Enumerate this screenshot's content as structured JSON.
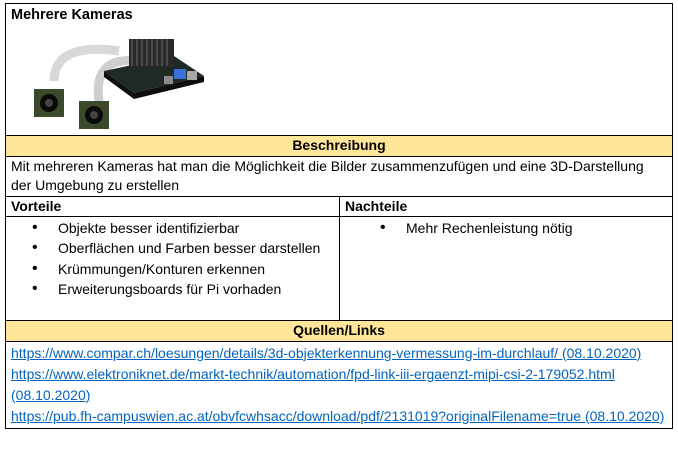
{
  "title": "Mehrere Kameras",
  "sections": {
    "beschreibung": "Beschreibung",
    "quellen": "Quellen/Links"
  },
  "description": "Mit mehreren Kameras hat man die Möglichkeit die Bilder zusammenzufügen und eine 3D-Darstellung der Umgebung zu erstellen",
  "vorteile": {
    "heading": "Vorteile",
    "items": [
      "Objekte besser identifizierbar",
      "Oberflächen und Farben besser darstellen",
      "Krümmungen/Konturen erkennen",
      "Erweiterungsboards für Pi vorhaden"
    ]
  },
  "nachteile": {
    "heading": "Nachteile",
    "items": [
      "Mehr Rechenleistung nötig"
    ]
  },
  "links": [
    "https://www.compar.ch/loesungen/details/3d-objekterkennung-vermessung-im-durchlauf/ (08.10.2020)",
    "https://www.elektroniknet.de/markt-technik/automation/fpd-link-iii-ergaenzt-mipi-csi-2-179052.html (08.10.2020)",
    "https://pub.fh-campuswien.ac.at/obvfcwhsacc/download/pdf/2131019?originalFilename=true (08.10.2020)"
  ],
  "colors": {
    "section_bg": "#FFE699",
    "link": "#0563C1"
  },
  "image": "multi-camera-board-image"
}
